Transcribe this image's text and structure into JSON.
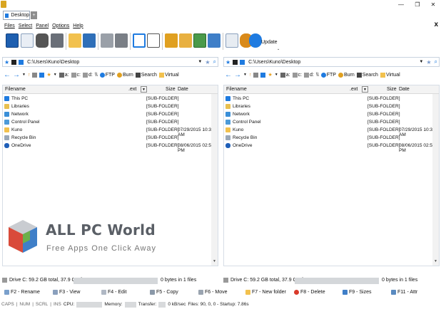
{
  "window": {
    "tab_title": "Desktop",
    "new_tab_symbol": "+",
    "controls": {
      "minimize": "—",
      "maximize": "❐",
      "close": "✕"
    },
    "menu_close": "x"
  },
  "menu": [
    "Files",
    "Select",
    "Panel",
    "Options",
    "Help"
  ],
  "toolbar": {
    "update_label": "Update",
    "more_symbol": "⌄",
    "icons": [
      "cmd-icon",
      "info-icon",
      "search-binoculars-icon",
      "sync-icon",
      "folder-network-icon",
      "computer-icon",
      "ftp-icon",
      "connect-icon",
      "split-icon",
      "copy-panel-icon",
      "lock-icon",
      "unlock-icon",
      "image-icon",
      "picture-icon",
      "slideshow-icon",
      "notepad-icon",
      "bug-icon",
      "globe-icon"
    ]
  },
  "panels": [
    {
      "id": "left",
      "path": "C:\\Users\\Kuno\\Desktop",
      "drives": [
        "a:",
        "c:",
        "d:",
        "\\\\",
        "FTP",
        "Burn",
        "Search",
        "Virtual"
      ],
      "columns": {
        "name": "Filename",
        "ext": ".ext",
        "size": "Size",
        "date": "Date"
      },
      "rows": [
        {
          "name": "This PC",
          "size": "[SUB-FOLDER]",
          "date": ""
        },
        {
          "name": "Libraries",
          "size": "[SUB-FOLDER]",
          "date": ""
        },
        {
          "name": "Network",
          "size": "[SUB-FOLDER]",
          "date": ""
        },
        {
          "name": "Control Panel",
          "size": "[SUB-FOLDER]",
          "date": ""
        },
        {
          "name": "Kuno",
          "size": "[SUB-FOLDER]",
          "date": "07/29/2015 10:38 AM"
        },
        {
          "name": "Recycle Bin",
          "size": "[SUB-FOLDER]",
          "date": ""
        },
        {
          "name": "OneDrive",
          "size": "[SUB-FOLDER]",
          "date": "08/06/2015 02:56 PM"
        }
      ],
      "drive_info": "Drive C: 59.2 GB total, 37.9 GB free",
      "selection_info": "0 bytes in 1 files"
    },
    {
      "id": "right",
      "path": "C:\\Users\\Kuno\\Desktop",
      "drives": [
        "a:",
        "c:",
        "d:",
        "\\\\",
        "FTP",
        "Burn",
        "Search",
        "Virtual"
      ],
      "columns": {
        "name": "Filename",
        "ext": ".ext",
        "size": "Size",
        "date": "Date"
      },
      "rows": [
        {
          "name": "This PC",
          "size": "[SUB-FOLDER]",
          "date": ""
        },
        {
          "name": "Libraries",
          "size": "[SUB-FOLDER]",
          "date": ""
        },
        {
          "name": "Network",
          "size": "[SUB-FOLDER]",
          "date": ""
        },
        {
          "name": "Control Panel",
          "size": "[SUB-FOLDER]",
          "date": ""
        },
        {
          "name": "Kuno",
          "size": "[SUB-FOLDER]",
          "date": "07/29/2015 10:38 AM"
        },
        {
          "name": "Recycle Bin",
          "size": "[SUB-FOLDER]",
          "date": ""
        },
        {
          "name": "OneDrive",
          "size": "[SUB-FOLDER]",
          "date": "08/06/2015 02:56 PM"
        }
      ],
      "drive_info": "Drive C: 59.2 GB total, 37.9 GB free",
      "selection_info": "0 bytes in 1 files"
    }
  ],
  "function_keys": [
    "F2 - Rename",
    "F3 - View",
    "F4 - Edit",
    "F5 - Copy",
    "F6 - Move",
    "F7 - New folder",
    "F8 - Delete",
    "F9 - Sizes",
    "F11 - Attr"
  ],
  "status": {
    "caps": "CAPS",
    "num": "NUM",
    "scrl": "SCRL",
    "ins": "INS",
    "cpu_label": "CPU:",
    "memory_label": "Memory:",
    "transfer_label": "Transfer:",
    "transfer_value": "0 kB/sec",
    "files_info": "Files: 90, 0, 0 - Startup: 7.86s"
  },
  "watermark": {
    "title": "ALL PC World",
    "subtitle": "Free Apps One Click Away"
  },
  "colors": {
    "accent_blue": "#1f7be0",
    "folder_yellow": "#f2c14e",
    "panel_border": "#c9d3df"
  }
}
